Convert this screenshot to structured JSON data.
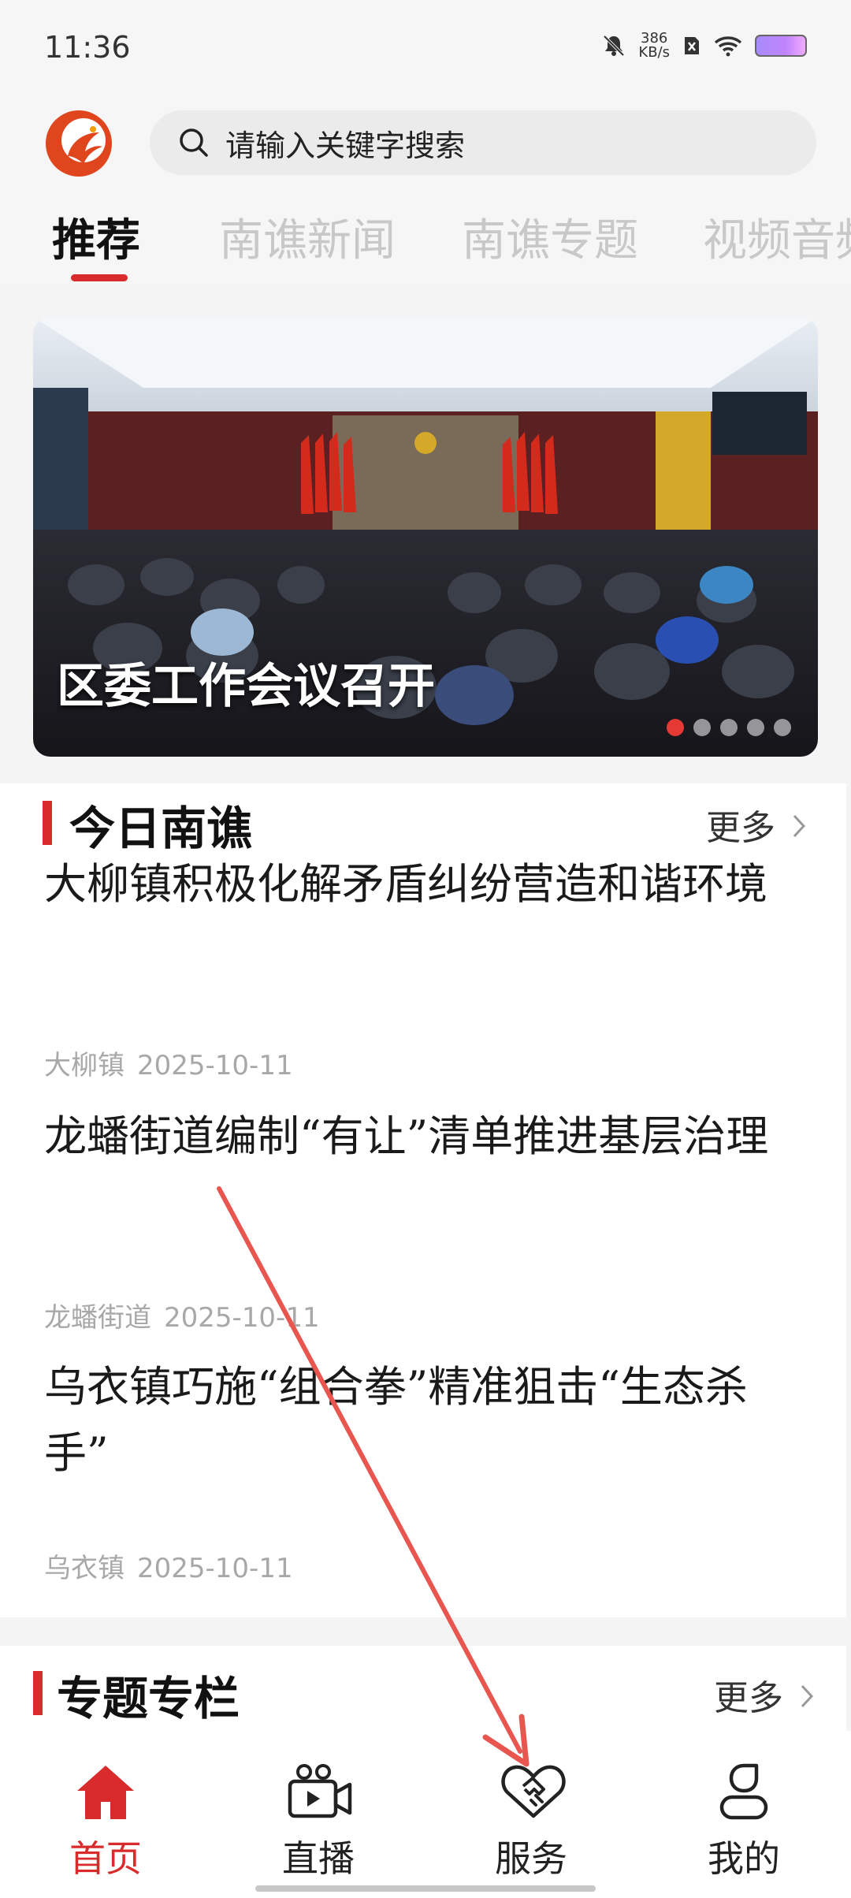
{
  "status_bar": {
    "time": "11:36",
    "speed_value": "386",
    "speed_unit": "KB/s"
  },
  "search": {
    "placeholder": "请输入关键字搜索"
  },
  "tabs": [
    {
      "label": "推荐",
      "active": true
    },
    {
      "label": "南谯新闻",
      "active": false
    },
    {
      "label": "南谯专题",
      "active": false
    },
    {
      "label": "视频音频",
      "active": false
    }
  ],
  "banner": {
    "title": "区委工作会议召开",
    "slide_count": 5,
    "active_slide": 1
  },
  "today_section": {
    "title": "今日南谯",
    "more_label": "更多",
    "articles": [
      {
        "title": "大柳镇积极化解矛盾纠纷营造和谐环境",
        "source": "大柳镇",
        "date": "2025-10-11"
      },
      {
        "title": "龙蟠街道编制“有让”清单推进基层治理",
        "source": "龙蟠街道",
        "date": "2025-10-11"
      },
      {
        "title": "乌衣镇巧施“组合拳”精准狙击“生态杀手”",
        "source": "乌衣镇",
        "date": "2025-10-11"
      }
    ]
  },
  "special_section": {
    "title": "专题专栏",
    "more_label": "更多"
  },
  "bottom_nav": [
    {
      "label": "首页",
      "icon": "home-icon",
      "active": true
    },
    {
      "label": "直播",
      "icon": "video-camera-icon",
      "active": false
    },
    {
      "label": "服务",
      "icon": "handshake-icon",
      "active": false
    },
    {
      "label": "我的",
      "icon": "user-icon",
      "active": false
    }
  ],
  "colors": {
    "accent": "#d92b2b",
    "annotation_arrow": "#e8564f"
  }
}
